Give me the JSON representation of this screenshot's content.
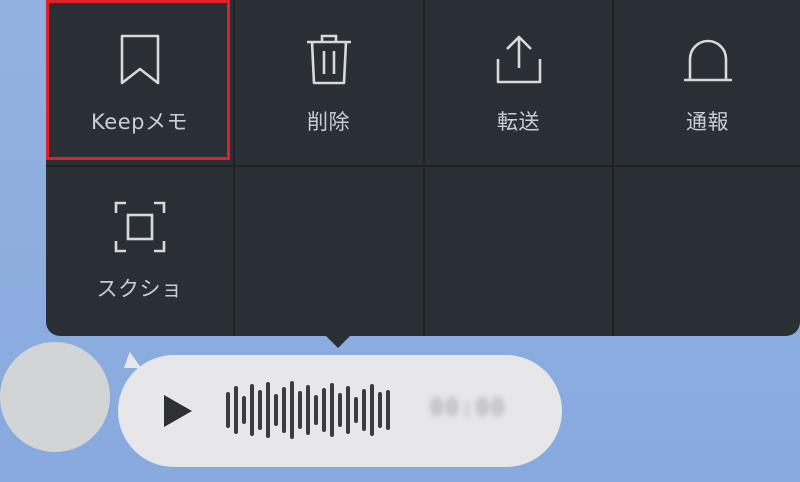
{
  "menu": {
    "items": [
      {
        "label": "Keepメモ",
        "icon": "bookmark-icon"
      },
      {
        "label": "削除",
        "icon": "trash-icon"
      },
      {
        "label": "転送",
        "icon": "share-icon"
      },
      {
        "label": "通報",
        "icon": "alert-bell-icon"
      },
      {
        "label": "スクショ",
        "icon": "screenshot-frame-icon"
      }
    ]
  },
  "message": {
    "type": "voice",
    "duration": "00:00",
    "play_icon": "play-icon"
  },
  "colors": {
    "menu_bg": "#2a2e35",
    "highlight": "#e0202a",
    "chat_bg": "#8fb0e0",
    "bubble": "#e7e7e9"
  }
}
